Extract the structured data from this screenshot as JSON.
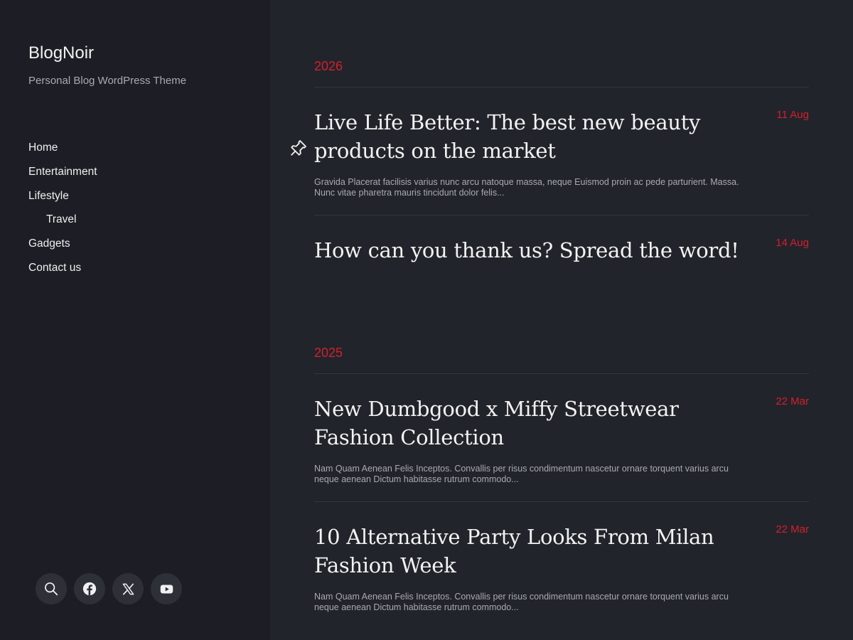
{
  "site": {
    "title": "BlogNoir",
    "tagline": "Personal Blog WordPress Theme"
  },
  "nav": {
    "items": [
      {
        "label": "Home"
      },
      {
        "label": "Entertainment"
      },
      {
        "label": "Lifestyle"
      },
      {
        "label": "Travel"
      },
      {
        "label": "Gadgets"
      },
      {
        "label": "Contact us"
      }
    ]
  },
  "social": {
    "icons": [
      "search-icon",
      "facebook-icon",
      "x-icon",
      "youtube-icon"
    ]
  },
  "archive": {
    "groups": [
      {
        "year": "2026",
        "posts": [
          {
            "title": "Live Life Better: The best new beauty products on the market",
            "date": "11 Aug",
            "excerpt": "Gravida Placerat facilisis varius nunc arcu natoque massa, neque Euismod proin ac pede parturient. Massa. Nunc vitae pharetra mauris tincidunt dolor felis...",
            "pinned": true
          },
          {
            "title": "How can you thank us? Spread the word!",
            "date": "14 Aug",
            "excerpt": ""
          }
        ]
      },
      {
        "year": "2025",
        "posts": [
          {
            "title": "New Dumbgood x Miffy Streetwear Fashion Collection",
            "date": "22 Mar",
            "excerpt": "Nam Quam Aenean Felis Inceptos. Convallis per risus condimentum nascetur ornare torquent varius arcu neque aenean Dictum habitasse rutrum commodo..."
          },
          {
            "title": "10 Alternative Party Looks From Milan Fashion Week",
            "date": "22 Mar",
            "excerpt": "Nam Quam Aenean Felis Inceptos. Convallis per risus condimentum nascetur ornare torquent varius arcu neque aenean Dictum habitasse rutrum commodo..."
          }
        ]
      }
    ]
  },
  "colors": {
    "accent": "#d41f2c",
    "sidebar_bg": "#1d1e25",
    "main_bg": "#22242b"
  }
}
